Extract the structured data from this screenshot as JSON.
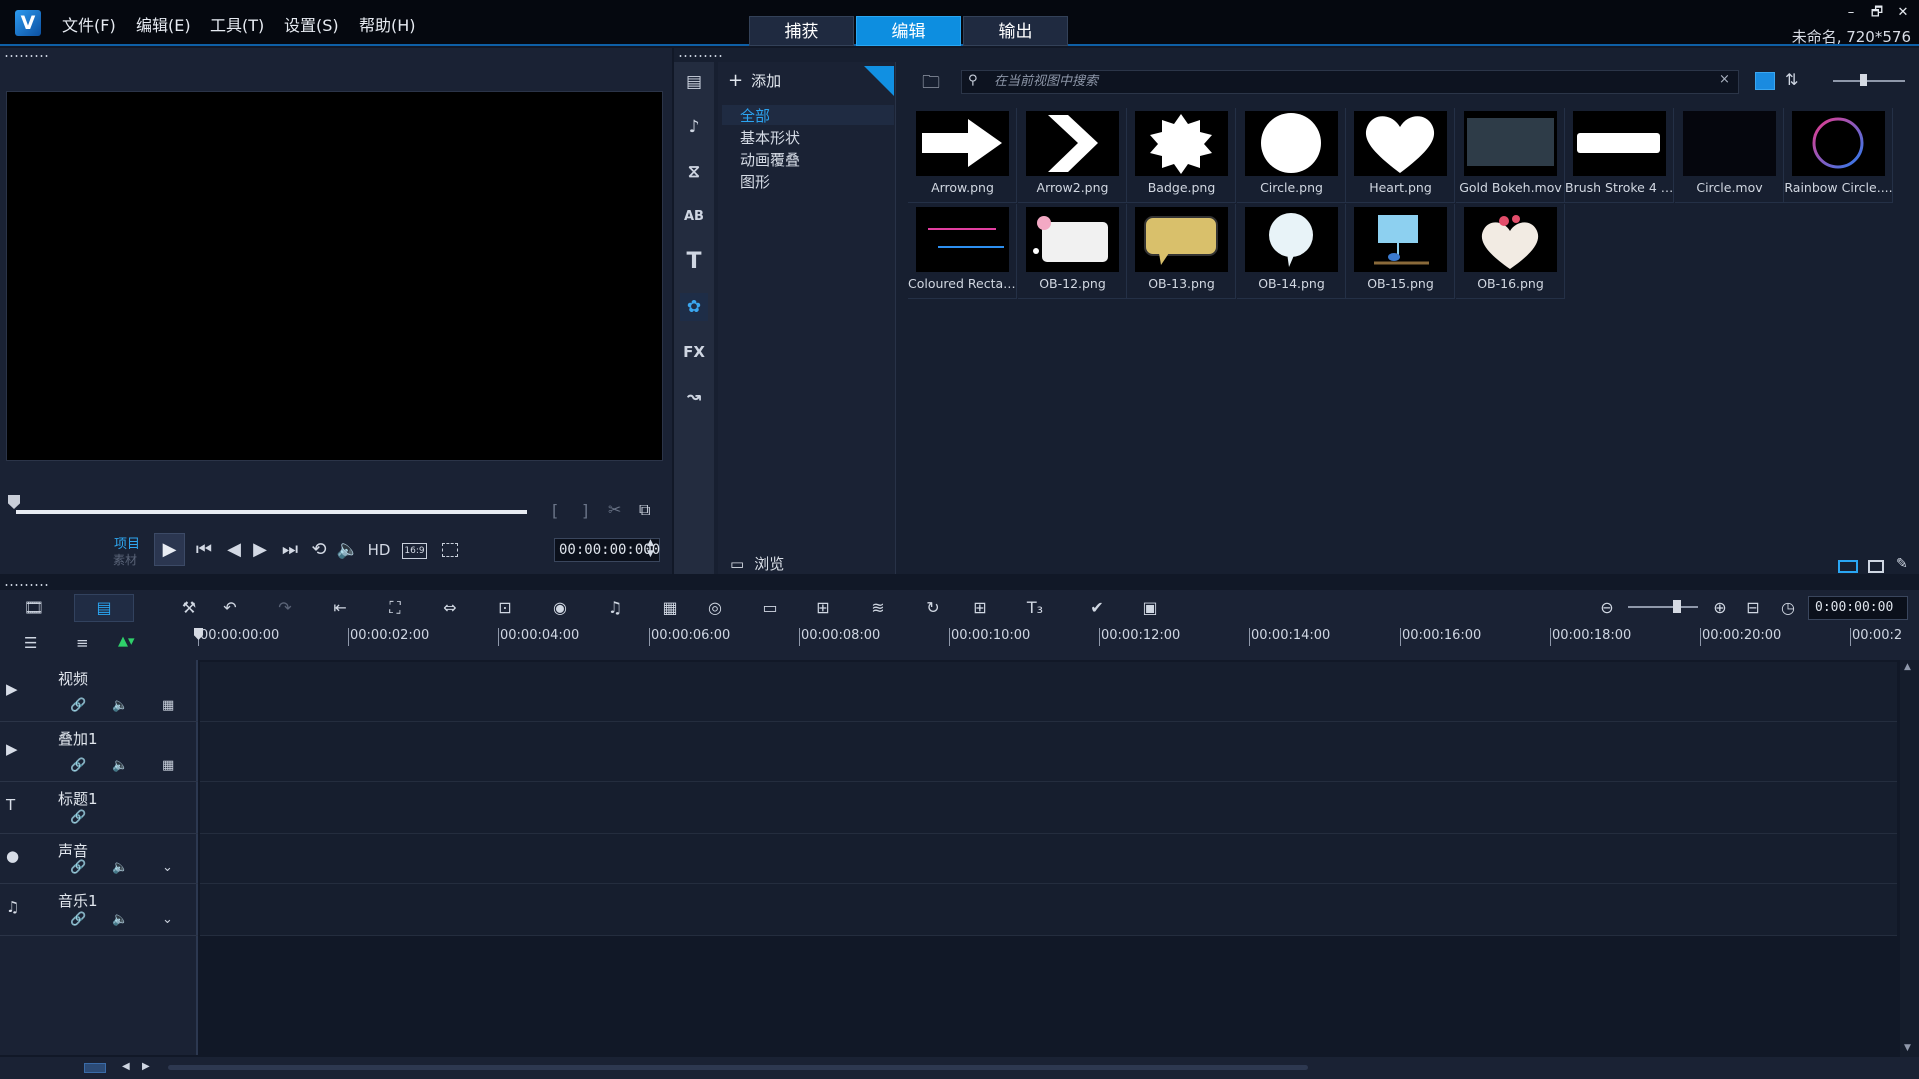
{
  "app": {
    "logo_text": "V",
    "menu": [
      "文件(F)",
      "编辑(E)",
      "工具(T)",
      "设置(S)",
      "帮助(H)"
    ],
    "mode_tabs": [
      "捕获",
      "编辑",
      "输出"
    ],
    "active_tab": "编辑",
    "project_info": "未命名, 720*576",
    "window_buttons": [
      "–",
      "🗗",
      "✕"
    ]
  },
  "player": {
    "project_label": "项目",
    "clip_label": "素材",
    "hd_label": "HD",
    "aspect_label": "16:9",
    "timecode": "00:00:00:000",
    "controls": [
      "play",
      "to-start",
      "prev-frame",
      "next-frame",
      "to-end",
      "repeat",
      "volume"
    ]
  },
  "library": {
    "add_label": "添加",
    "folders": [
      "全部",
      "基本形状",
      "动画覆叠",
      "图形"
    ],
    "active_folder": "全部",
    "browse_label": "浏览",
    "search_placeholder": "在当前视图中搜索",
    "sidebar_icons": [
      "media-icon",
      "instant-project-icon",
      "transition-icon",
      "title-icon",
      "text-icon",
      "overlay-icon",
      "fx-icon",
      "path-icon"
    ],
    "items": [
      {
        "name": "Arrow.png",
        "kind": "arrow"
      },
      {
        "name": "Arrow2.png",
        "kind": "chevron"
      },
      {
        "name": "Badge.png",
        "kind": "badge"
      },
      {
        "name": "Circle.png",
        "kind": "circle"
      },
      {
        "name": "Heart.png",
        "kind": "heart"
      },
      {
        "name": "Gold Bokeh.mov",
        "kind": "bokeh"
      },
      {
        "name": "Brush Stroke 4 L...",
        "kind": "brush"
      },
      {
        "name": "Circle.mov",
        "kind": "dark"
      },
      {
        "name": "Rainbow Circle....",
        "kind": "ring"
      },
      {
        "name": "Coloured Rectan...",
        "kind": "lines"
      },
      {
        "name": "OB-12.png",
        "kind": "ob12"
      },
      {
        "name": "OB-13.png",
        "kind": "ob13"
      },
      {
        "name": "OB-14.png",
        "kind": "ob14"
      },
      {
        "name": "OB-15.png",
        "kind": "ob15"
      },
      {
        "name": "OB-16.png",
        "kind": "ob16"
      }
    ]
  },
  "timeline": {
    "timecode": "0:00:00:00",
    "ruler": [
      "00:00:00:00",
      "00:00:02:00",
      "00:00:04:00",
      "00:00:06:00",
      "00:00:08:00",
      "00:00:10:00",
      "00:00:12:00",
      "00:00:14:00",
      "00:00:16:00",
      "00:00:18:00",
      "00:00:20:00",
      "00:00:2"
    ],
    "tracks": [
      {
        "name": "视频",
        "icon": "video-track-icon"
      },
      {
        "name": "叠加1",
        "icon": "overlay-track-icon"
      },
      {
        "name": "标题1",
        "icon": "title-track-icon"
      },
      {
        "name": "声音",
        "icon": "voice-track-icon"
      },
      {
        "name": "音乐1",
        "icon": "music-track-icon"
      }
    ]
  },
  "colors": {
    "accent": "#0d8ee0",
    "bg": "#111827",
    "panel": "#1a2234"
  }
}
